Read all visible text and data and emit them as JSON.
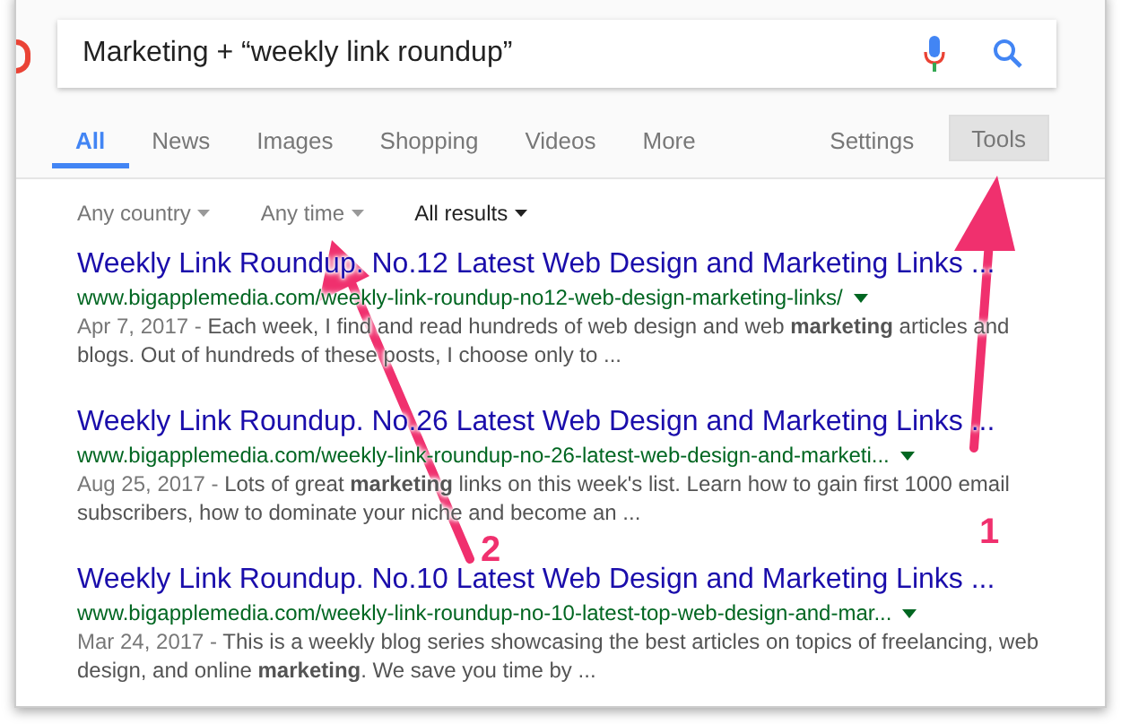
{
  "search": {
    "value": "Marketing + “weekly link roundup”"
  },
  "tabs": [
    {
      "label": "All",
      "selected": true
    },
    {
      "label": "News",
      "selected": false
    },
    {
      "label": "Images",
      "selected": false
    },
    {
      "label": "Shopping",
      "selected": false
    },
    {
      "label": "Videos",
      "selected": false
    },
    {
      "label": "More",
      "selected": false
    }
  ],
  "settings": "Settings",
  "tools": {
    "label": "Tools",
    "selected": true
  },
  "filters": [
    {
      "label": "Any country",
      "active": false
    },
    {
      "label": "Any time",
      "active": false
    },
    {
      "label": "All results",
      "active": true
    }
  ],
  "results": [
    {
      "title": "Weekly Link Roundup. No.12 Latest Web Design and Marketing Links ...",
      "url": "www.bigapplemedia.com/weekly-link-roundup-no12-web-design-marketing-links/",
      "date": "Apr 7, 2017 - ",
      "snippet": "Each week, I find and read hundreds of web design and web **marketing** articles and blogs. Out of hundreds of these posts, I choose only to ..."
    },
    {
      "title": "Weekly Link Roundup. No.26 Latest Web Design and Marketing Links ...",
      "url": "www.bigapplemedia.com/weekly-link-roundup-no-26-latest-web-design-and-marketi...",
      "date": "Aug 25, 2017 - ",
      "snippet": "Lots of great **marketing** links on this week's list. Learn how to gain first 1000 email subscribers, how to dominate your niche and become an ..."
    },
    {
      "title": "Weekly Link Roundup. No.10 Latest Web Design and Marketing Links ...",
      "url": "www.bigapplemedia.com/weekly-link-roundup-no-10-latest-top-web-design-and-mar...",
      "date": "Mar 24, 2017 - ",
      "snippet": "This is a weekly blog series showcasing the best articles on topics of freelancing, web design, and online **marketing**. We save you time by ..."
    }
  ],
  "annotations": [
    {
      "label": "1"
    },
    {
      "label": "2"
    }
  ]
}
